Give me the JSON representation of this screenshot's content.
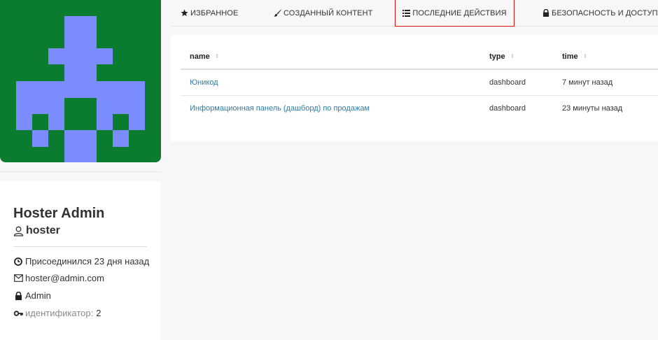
{
  "profile": {
    "full_name": "Hoster Admin",
    "username": "hoster",
    "joined": "Присоединился 23 дня назад",
    "email": "hoster@admin.com",
    "role": "Admin",
    "id_label": "идентификатор:",
    "id_value": "2"
  },
  "tabs": [
    {
      "label": "ИЗБРАННОЕ",
      "icon": "star-icon"
    },
    {
      "label": "СОЗДАННЫЙ КОНТЕНТ",
      "icon": "paintbrush-icon"
    },
    {
      "label": "ПОСЛЕДНИЕ ДЕЙСТВИЯ",
      "icon": "list-icon",
      "active": true
    },
    {
      "label": "БЕЗОПАСНОСТЬ И ДОСТУП",
      "icon": "lock-icon"
    }
  ],
  "table": {
    "columns": [
      "name",
      "type",
      "time"
    ],
    "rows": [
      {
        "name": "Юникод",
        "type": "dashboard",
        "time": "7 минут назад"
      },
      {
        "name": "Информационная панель (дашборд) по продажам",
        "type": "dashboard",
        "time": "23 минуты назад"
      }
    ]
  },
  "colors": {
    "avatar_bg": "#0b7b30",
    "avatar_fg": "#7b8cff",
    "link": "#2a7da8",
    "active_tab_outline": "#dd1111"
  }
}
